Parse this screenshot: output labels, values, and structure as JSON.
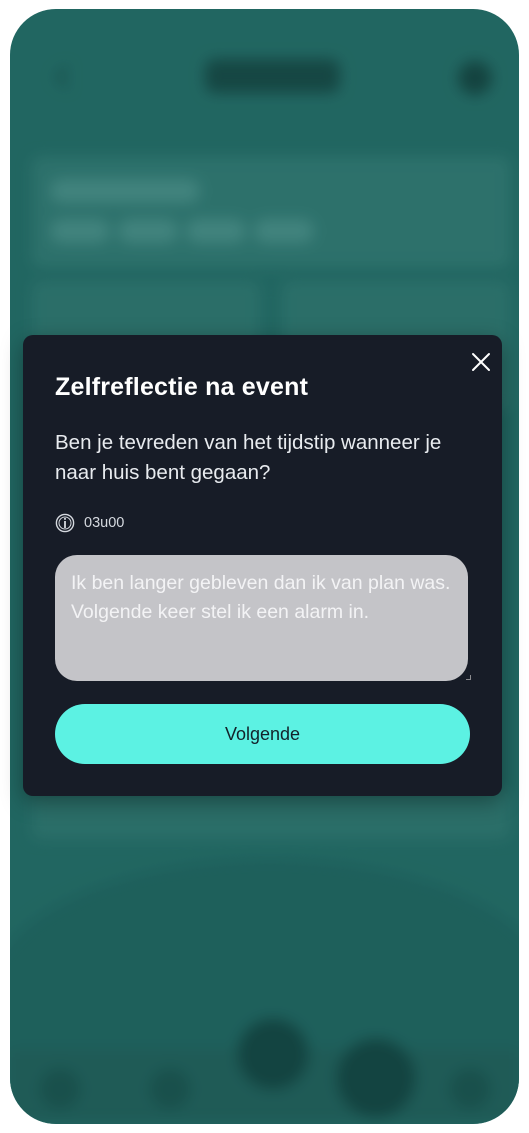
{
  "modal": {
    "title": "Zelfreflectie na event",
    "question": "Ben je tevreden van het tijdstip wanneer je naar huis bent gegaan?",
    "time_label": "03u00",
    "answer_text": "Ik ben langer gebleven dan ik van plan was. Volgende keer stel ik een alarm in.",
    "next_label": "Volgende",
    "close_icon": "close-icon",
    "info_icon": "info-icon"
  },
  "colors": {
    "background_teal": "#2f7f78",
    "modal_bg": "#171c27",
    "button_accent": "#5cf2e3",
    "input_bg": "#c4c4c8"
  }
}
